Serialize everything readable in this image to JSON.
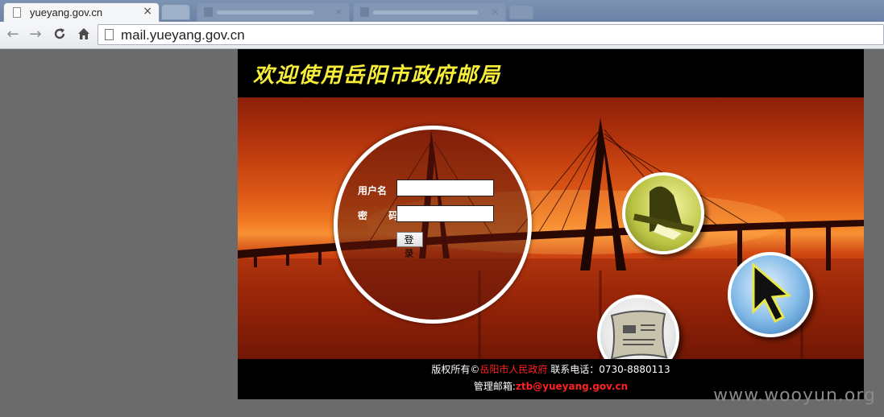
{
  "browser": {
    "active_tab": {
      "title": "yueyang.gov.cn",
      "close": "×"
    },
    "address": {
      "url": "mail.yueyang.gov.cn"
    },
    "nav": {
      "back": "←",
      "forward": "→",
      "reload": "C",
      "home": "⌂"
    }
  },
  "page": {
    "header_title": "欢迎使用岳阳市政府邮局",
    "login": {
      "username_label": "用户名",
      "password_label": "密 码",
      "username_value": "",
      "password_value": "",
      "submit_label": "登 录"
    },
    "footer": {
      "copyright_prefix": "版权所有©",
      "owner": "岳阳市人民政府",
      "phone_label": " 联系电话：",
      "phone": "0730-8880113",
      "admin_label": "管理邮箱:",
      "admin_email": "ztb@yueyang.gov.cn"
    },
    "icons": [
      "people-working-icon",
      "cursor-arrow-icon",
      "newspaper-mail-icon"
    ]
  },
  "watermark": "www.wooyun.org",
  "colors": {
    "header_title": "#f7ee3a",
    "footer_highlight": "#ff2020",
    "page_background": "#6b6b6b"
  }
}
